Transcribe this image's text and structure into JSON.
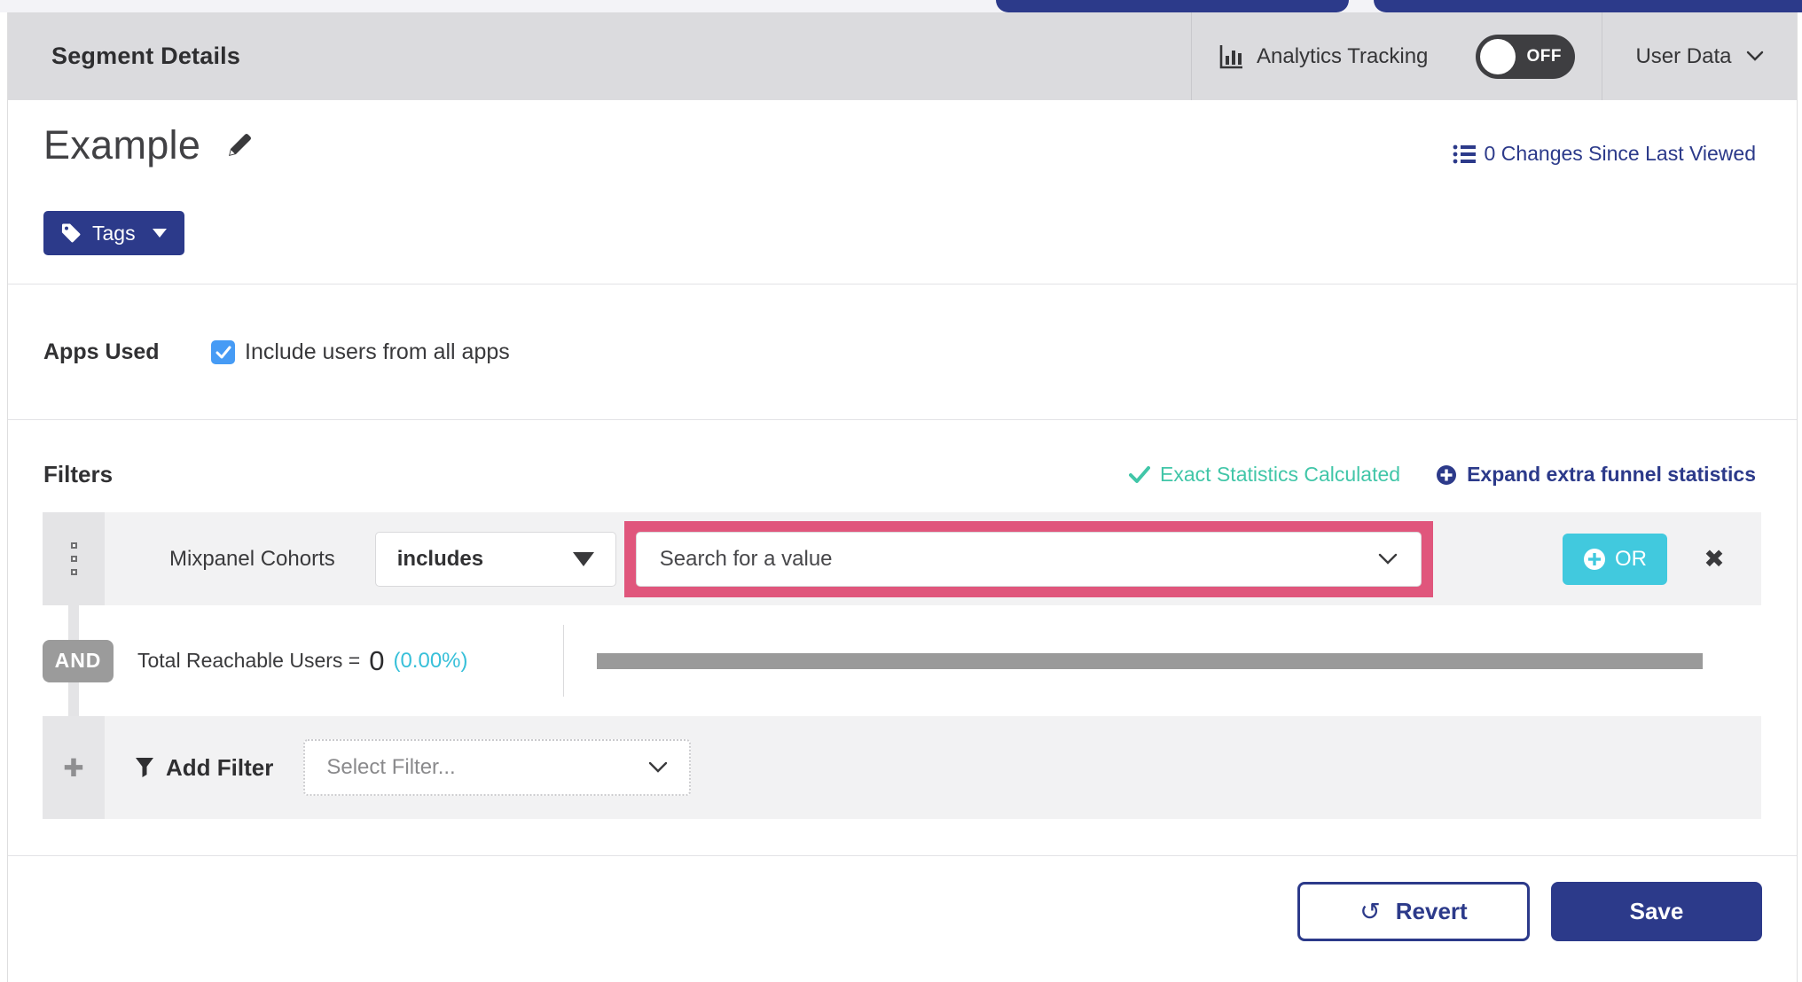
{
  "header": {
    "title": "Segment Details",
    "analytics_label": "Analytics Tracking",
    "toggle_state": "OFF",
    "user_data_label": "User Data"
  },
  "segment": {
    "name": "Example",
    "tags_button": "Tags",
    "changes_link": "0 Changes Since Last Viewed"
  },
  "apps": {
    "label": "Apps Used",
    "include_all_label": "Include users from all apps",
    "include_all_checked": true
  },
  "filters": {
    "heading": "Filters",
    "exact_stats_label": "Exact Statistics Calculated",
    "expand_stats_label": "Expand extra funnel statistics",
    "filter_row": {
      "field_label": "Mixpanel Cohorts",
      "operator_value": "includes",
      "value_placeholder": "Search for a value",
      "or_button": "OR",
      "remove_glyph": "✖"
    },
    "conjunction": "AND",
    "reachable": {
      "label": "Total Reachable Users =",
      "value": "0",
      "percent": "(0.00%)"
    },
    "add_filter": {
      "plus_glyph": "✚",
      "label": "Add Filter",
      "placeholder": "Select Filter..."
    }
  },
  "footer": {
    "revert": "Revert",
    "revert_icon_glyph": "↺",
    "save": "Save"
  },
  "colors": {
    "navy": "#2c3a8a",
    "teal_or_button": "#41c9de",
    "green_exact_stats": "#41c6a8",
    "cyan_percent": "#38c0d9",
    "pink_highlight": "#e0567c",
    "checkbox_blue": "#469bf5",
    "header_gray": "#dbdbde",
    "row_gray": "#f2f2f3"
  }
}
